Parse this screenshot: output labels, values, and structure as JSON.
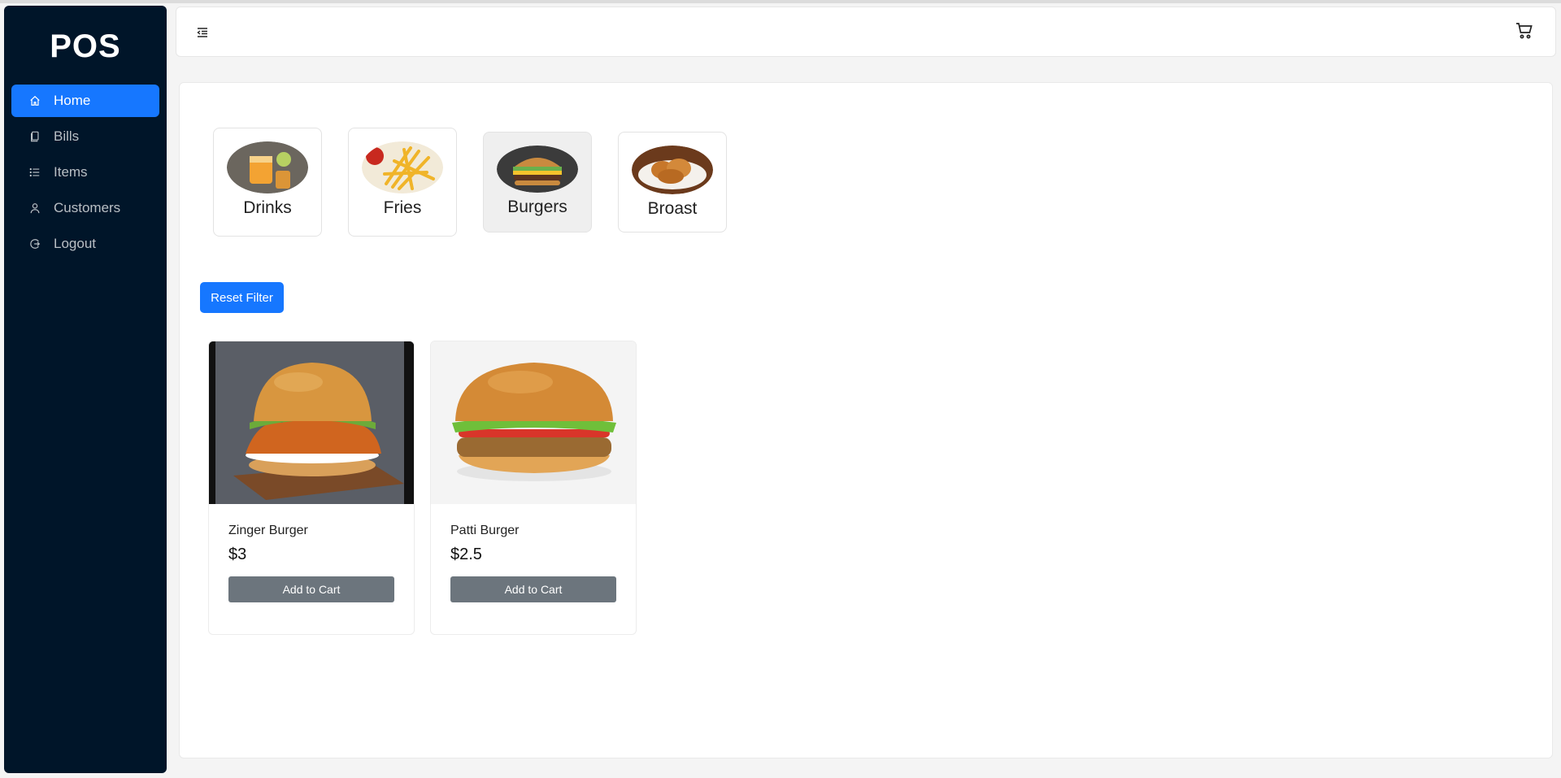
{
  "app": {
    "title": "POS"
  },
  "sidebar": {
    "items": [
      {
        "label": "Home",
        "icon": "home-icon",
        "active": true
      },
      {
        "label": "Bills",
        "icon": "copy-icon",
        "active": false
      },
      {
        "label": "Items",
        "icon": "list-icon",
        "active": false
      },
      {
        "label": "Customers",
        "icon": "user-icon",
        "active": false
      },
      {
        "label": "Logout",
        "icon": "logout-icon",
        "active": false
      }
    ]
  },
  "header": {
    "menu_toggle_icon": "menu-fold-icon",
    "cart_icon": "shopping-cart-icon"
  },
  "categories": [
    {
      "label": "Drinks",
      "selected": false
    },
    {
      "label": "Fries",
      "selected": false
    },
    {
      "label": "Burgers",
      "selected": true
    },
    {
      "label": "Broast",
      "selected": false
    }
  ],
  "filter": {
    "reset_label": "Reset Filter"
  },
  "items": [
    {
      "name": "Zinger Burger",
      "price": "$3",
      "button": "Add to Cart"
    },
    {
      "name": "Patti Burger",
      "price": "$2.5",
      "button": "Add to Cart"
    }
  ],
  "colors": {
    "sidebar_bg": "#001529",
    "primary": "#1677ff",
    "button_secondary": "#6c757d"
  }
}
